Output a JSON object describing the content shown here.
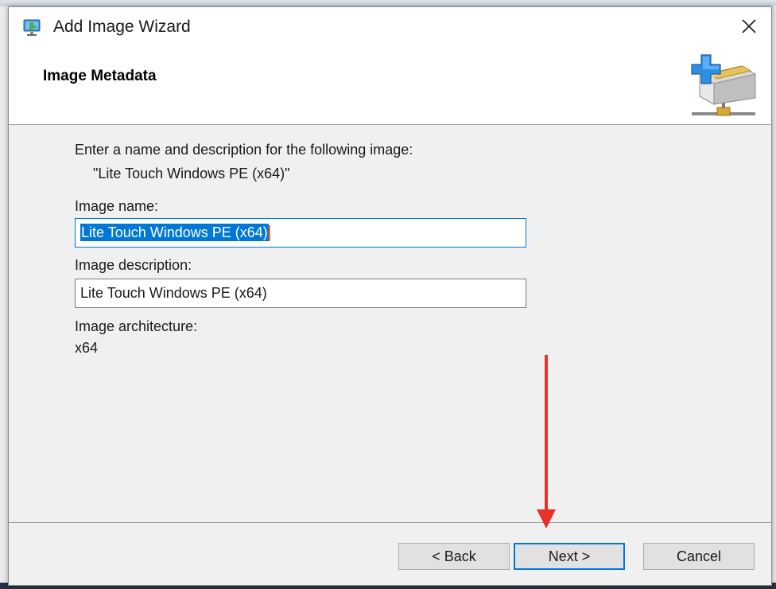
{
  "window": {
    "title": "Add Image Wizard",
    "close_symbol": "✕"
  },
  "header": {
    "page_title": "Image Metadata",
    "icon": "add-image-box-icon"
  },
  "form": {
    "intro": "Enter a name and description for the following image:",
    "image_quoted": "\"Lite Touch Windows PE (x64)\"",
    "name_label": "Image name:",
    "name_value": "Lite Touch Windows PE (x64)",
    "description_label": "Image description:",
    "description_value": "Lite Touch Windows PE (x64)",
    "architecture_label": "Image architecture:",
    "architecture_value": "x64"
  },
  "buttons": {
    "back": "< Back",
    "next": "Next >",
    "cancel": "Cancel"
  },
  "colors": {
    "accent": "#0078d7",
    "annotation_arrow": "#e8312a",
    "dialog_bg": "#f0f0f0"
  }
}
